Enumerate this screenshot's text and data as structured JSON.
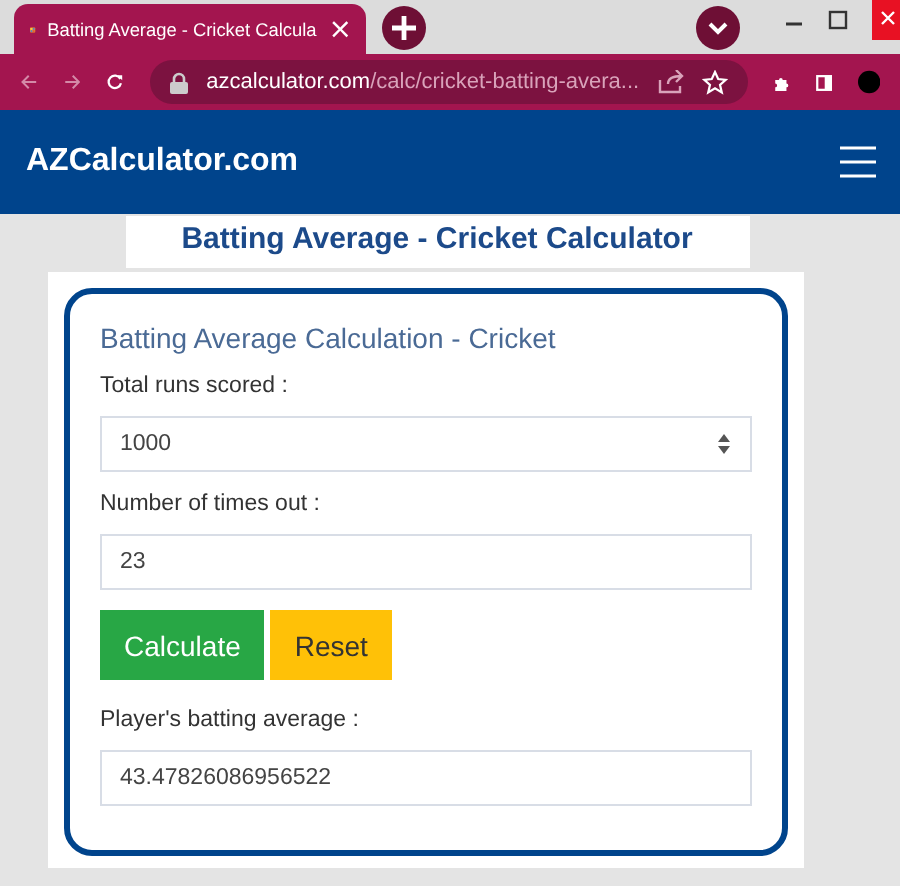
{
  "browser": {
    "tab_title": "Batting Average - Cricket Calcula",
    "tab_close": "×",
    "url_domain": "azcalculator.com",
    "url_path": "/calc/cricket-batting-avera..."
  },
  "site": {
    "logo": "AZCalculator.com",
    "page_title": "Batting Average - Cricket Calculator"
  },
  "calculator": {
    "heading": "Batting Average Calculation - Cricket",
    "fields": [
      {
        "kind": "number",
        "label": "Total runs scored :",
        "value": "1000"
      },
      {
        "kind": "text",
        "label": "Number of times out :",
        "value": "23"
      }
    ],
    "buttons": [
      {
        "kind": "primary",
        "label": "Calculate"
      },
      {
        "kind": "warning",
        "label": "Reset"
      }
    ],
    "result": {
      "label": "Player's batting average :",
      "value": "43.47826086956522"
    }
  }
}
